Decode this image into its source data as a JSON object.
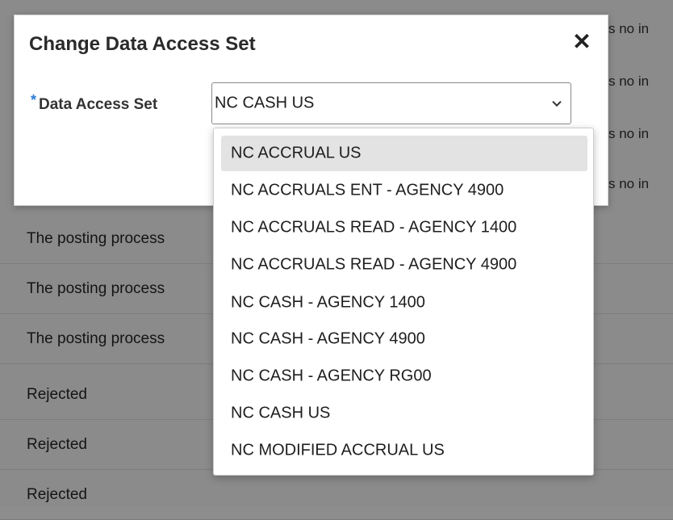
{
  "background": {
    "rows": [
      {
        "status": "The posting process"
      },
      {
        "status": "The posting process"
      },
      {
        "status": "The posting process"
      },
      {
        "status": "Rejected"
      },
      {
        "status": "Rejected"
      },
      {
        "status": "Rejected"
      }
    ],
    "right_snippets": [
      "s no in",
      "s no in",
      "s no in",
      "s no in"
    ]
  },
  "dialog": {
    "title": "Change Data Access Set",
    "close_icon": "close-icon",
    "field": {
      "required_marker": "*",
      "label": "Data Access Set",
      "selected_value": "NC CASH US"
    }
  },
  "dropdown": {
    "highlighted_index": 0,
    "options": [
      "NC ACCRUAL US",
      "NC ACCRUALS ENT - AGENCY 4900",
      "NC ACCRUALS READ - AGENCY 1400",
      "NC ACCRUALS READ - AGENCY 4900",
      "NC CASH - AGENCY 1400",
      "NC CASH - AGENCY 4900",
      "NC CASH - AGENCY RG00",
      "NC CASH US",
      "NC MODIFIED ACCRUAL US"
    ]
  },
  "colors": {
    "overlay_gray": "#8d8d8d",
    "required_star": "#2d7bd3",
    "highlight_bg": "#e3e3e3"
  }
}
